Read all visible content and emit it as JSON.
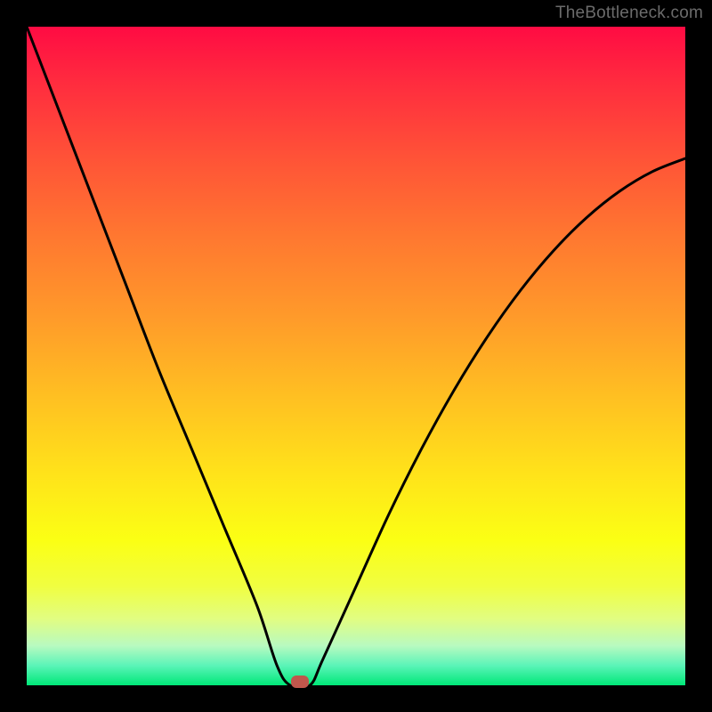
{
  "watermark": "TheBottleneck.com",
  "chart_data": {
    "type": "line",
    "title": "",
    "xlabel": "",
    "ylabel": "",
    "xlim": [
      0,
      100
    ],
    "ylim": [
      0,
      100
    ],
    "series": [
      {
        "name": "bottleneck-curve",
        "x": [
          0,
          5,
          10,
          15,
          20,
          25,
          30,
          35,
          38,
          40,
          43,
          45,
          50,
          55,
          60,
          65,
          70,
          75,
          80,
          85,
          90,
          95,
          100
        ],
        "values": [
          100,
          87,
          74,
          61,
          48,
          36,
          24,
          12,
          3,
          0,
          0,
          4,
          15,
          26,
          36,
          45,
          53,
          60,
          66,
          71,
          75,
          78,
          80
        ]
      }
    ],
    "marker": {
      "x": 41.5,
      "y": 0
    },
    "gradient": {
      "top": "#ff0b43",
      "mid1": "#ff9a2a",
      "mid2": "#ffe31a",
      "bottom": "#00e878"
    }
  }
}
